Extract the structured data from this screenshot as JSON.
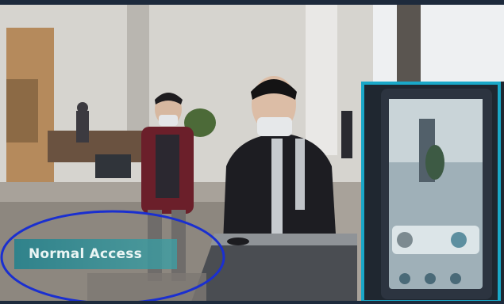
{
  "overlay": {
    "label": "Normal Access",
    "accent_color": "#2a8f96",
    "circle_color": "#1a2fd0",
    "panel_border_color": "#1aa8c8"
  }
}
